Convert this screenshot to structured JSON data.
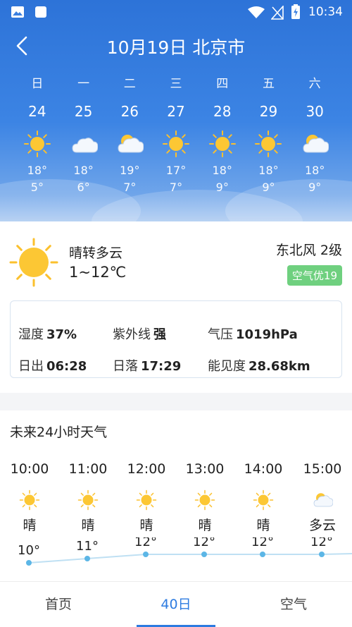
{
  "status_bar": {
    "time": "10:34"
  },
  "header": {
    "title": "10月19日 北京市"
  },
  "week": [
    {
      "dow": "日",
      "date": "24",
      "icon": "sun-icon",
      "high": "18°",
      "low": "5°"
    },
    {
      "dow": "一",
      "date": "25",
      "icon": "cloud-icon",
      "high": "18°",
      "low": "6°"
    },
    {
      "dow": "二",
      "date": "26",
      "icon": "partly-cloudy-icon",
      "high": "19°",
      "low": "7°"
    },
    {
      "dow": "三",
      "date": "27",
      "icon": "sun-icon",
      "high": "17°",
      "low": "7°"
    },
    {
      "dow": "四",
      "date": "28",
      "icon": "sun-icon",
      "high": "18°",
      "low": "9°"
    },
    {
      "dow": "五",
      "date": "29",
      "icon": "sun-icon",
      "high": "18°",
      "low": "9°"
    },
    {
      "dow": "六",
      "date": "30",
      "icon": "partly-cloudy-icon",
      "high": "18°",
      "low": "9°"
    }
  ],
  "today": {
    "condition": "晴转多云",
    "range": "1~12℃",
    "wind": "东北风 2级",
    "aqi": "空气优19",
    "humidity_label": "湿度",
    "humidity": "37%",
    "uv_label": "紫外线",
    "uv": "强",
    "pressure_label": "气压",
    "pressure": "1019hPa",
    "sunrise_label": "日出",
    "sunrise": "06:28",
    "sunset_label": "日落",
    "sunset": "17:29",
    "visibility_label": "能见度",
    "visibility": "28.68km"
  },
  "hourly": {
    "title": "未来24小时天气",
    "items": [
      {
        "time": "10:00",
        "icon": "sun-icon",
        "cond": "晴",
        "temp": "10°",
        "t": 10
      },
      {
        "time": "11:00",
        "icon": "sun-icon",
        "cond": "晴",
        "temp": "11°",
        "t": 11
      },
      {
        "time": "12:00",
        "icon": "sun-icon",
        "cond": "晴",
        "temp": "12°",
        "t": 12
      },
      {
        "time": "13:00",
        "icon": "sun-icon",
        "cond": "晴",
        "temp": "12°",
        "t": 12
      },
      {
        "time": "14:00",
        "icon": "sun-icon",
        "cond": "晴",
        "temp": "12°",
        "t": 12
      },
      {
        "time": "15:00",
        "icon": "partly-cloudy-icon",
        "cond": "多云",
        "temp": "12°",
        "t": 12
      }
    ]
  },
  "tabs": [
    {
      "label": "首页"
    },
    {
      "label": "40日"
    },
    {
      "label": "空气"
    }
  ],
  "colors": {
    "accent": "#2d7be0",
    "aqi_good": "#6fd07f",
    "sun": "#fbc02d"
  }
}
